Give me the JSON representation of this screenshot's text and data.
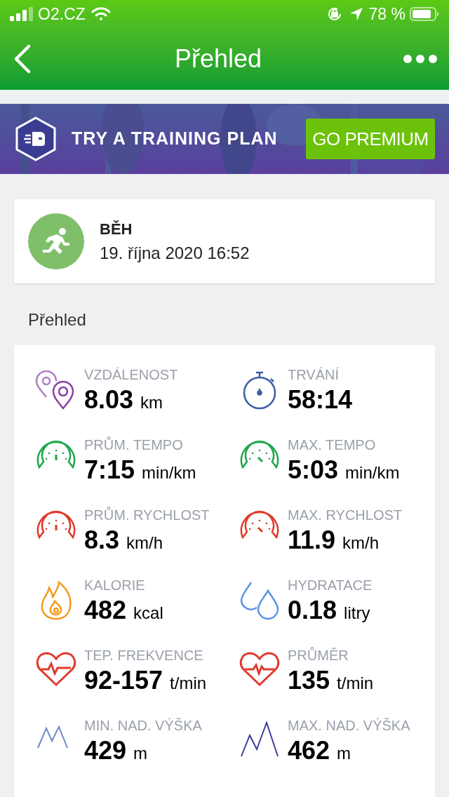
{
  "status_bar": {
    "carrier": "O2.CZ",
    "battery": "78 %"
  },
  "header": {
    "title": "Přehled"
  },
  "banner": {
    "text": "TRY A TRAINING PLAN",
    "button": "GO PREMIUM"
  },
  "workout": {
    "sport": "BĚH",
    "date": "19. října 2020 16:52"
  },
  "section_title": "Přehled",
  "stats": [
    {
      "kind": "distance",
      "label": "VZDÁLENOST",
      "value": "8.03",
      "unit": "km"
    },
    {
      "kind": "duration",
      "label": "TRVÁNÍ",
      "value": "58:14"
    },
    {
      "kind": "pace",
      "label": "PRŮM. TEMPO",
      "value": "7:15",
      "unit": "min/km"
    },
    {
      "kind": "maxpace",
      "label": "MAX. TEMPO",
      "value": "5:03",
      "unit": "min/km"
    },
    {
      "kind": "speed",
      "label": "PRŮM. RYCHLOST",
      "value": "8.3",
      "unit": "km/h"
    },
    {
      "kind": "maxspeed",
      "label": "MAX. RYCHLOST",
      "value": "11.9",
      "unit": "km/h"
    },
    {
      "kind": "calories",
      "label": "KALORIE",
      "value": "482",
      "unit": "kcal"
    },
    {
      "kind": "hydration",
      "label": "HYDRATACE",
      "value": "0.18",
      "unit": "litry"
    },
    {
      "kind": "heartrate",
      "label": "TEP. FREKVENCE",
      "value": "92-157",
      "unit": "t/min"
    },
    {
      "kind": "average",
      "label": "PRŮMĚR",
      "value": "135",
      "unit": "t/min"
    },
    {
      "kind": "minaltitude",
      "label": "MIN. NAD. VÝŠKA",
      "value": "429",
      "unit": "m"
    },
    {
      "kind": "maxaltitude",
      "label": "MAX. NAD. VÝŠKA",
      "value": "462",
      "unit": "m"
    }
  ]
}
